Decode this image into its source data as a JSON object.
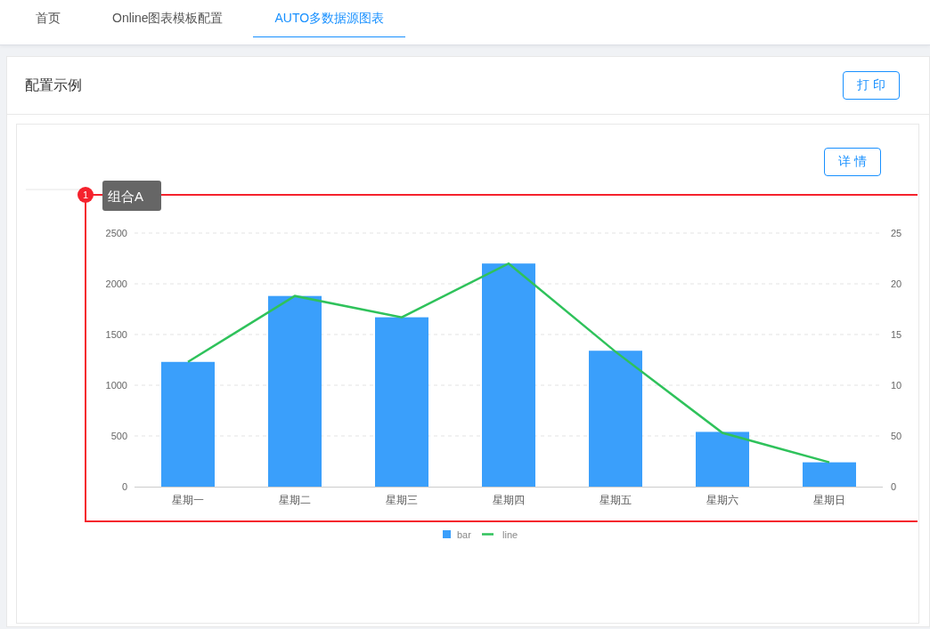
{
  "tabs": [
    {
      "label": "首页",
      "selected": false
    },
    {
      "label": "Online图表模板配置",
      "selected": false
    },
    {
      "label": "AUTO多数据源图表",
      "selected": true
    }
  ],
  "card": {
    "title": "配置示例",
    "print_button": "打 印",
    "detail_button": "详 情",
    "annotation": {
      "badge": "1",
      "label": "组合A"
    },
    "right_axis_labels": [
      "25",
      "20",
      "15",
      "10",
      "50",
      "0"
    ],
    "chart_data": {
      "type": "bar",
      "categories": [
        "星期一",
        "星期二",
        "星期三",
        "星期四",
        "星期五",
        "星期六",
        "星期日"
      ],
      "series": [
        {
          "name": "bar",
          "type": "bar",
          "color": "#3a9ffb",
          "values": [
            1230,
            1880,
            1670,
            2200,
            1340,
            540,
            240
          ]
        },
        {
          "name": "line",
          "type": "line",
          "color": "#2fc25b",
          "values": [
            1230,
            1880,
            1670,
            2200,
            1330,
            530,
            240
          ]
        }
      ],
      "stacked": false,
      "grid": true,
      "legend": "bottom",
      "ylim": [
        0,
        2500
      ],
      "yticks": [
        0,
        500,
        1000,
        1500,
        2000,
        2500
      ]
    }
  }
}
